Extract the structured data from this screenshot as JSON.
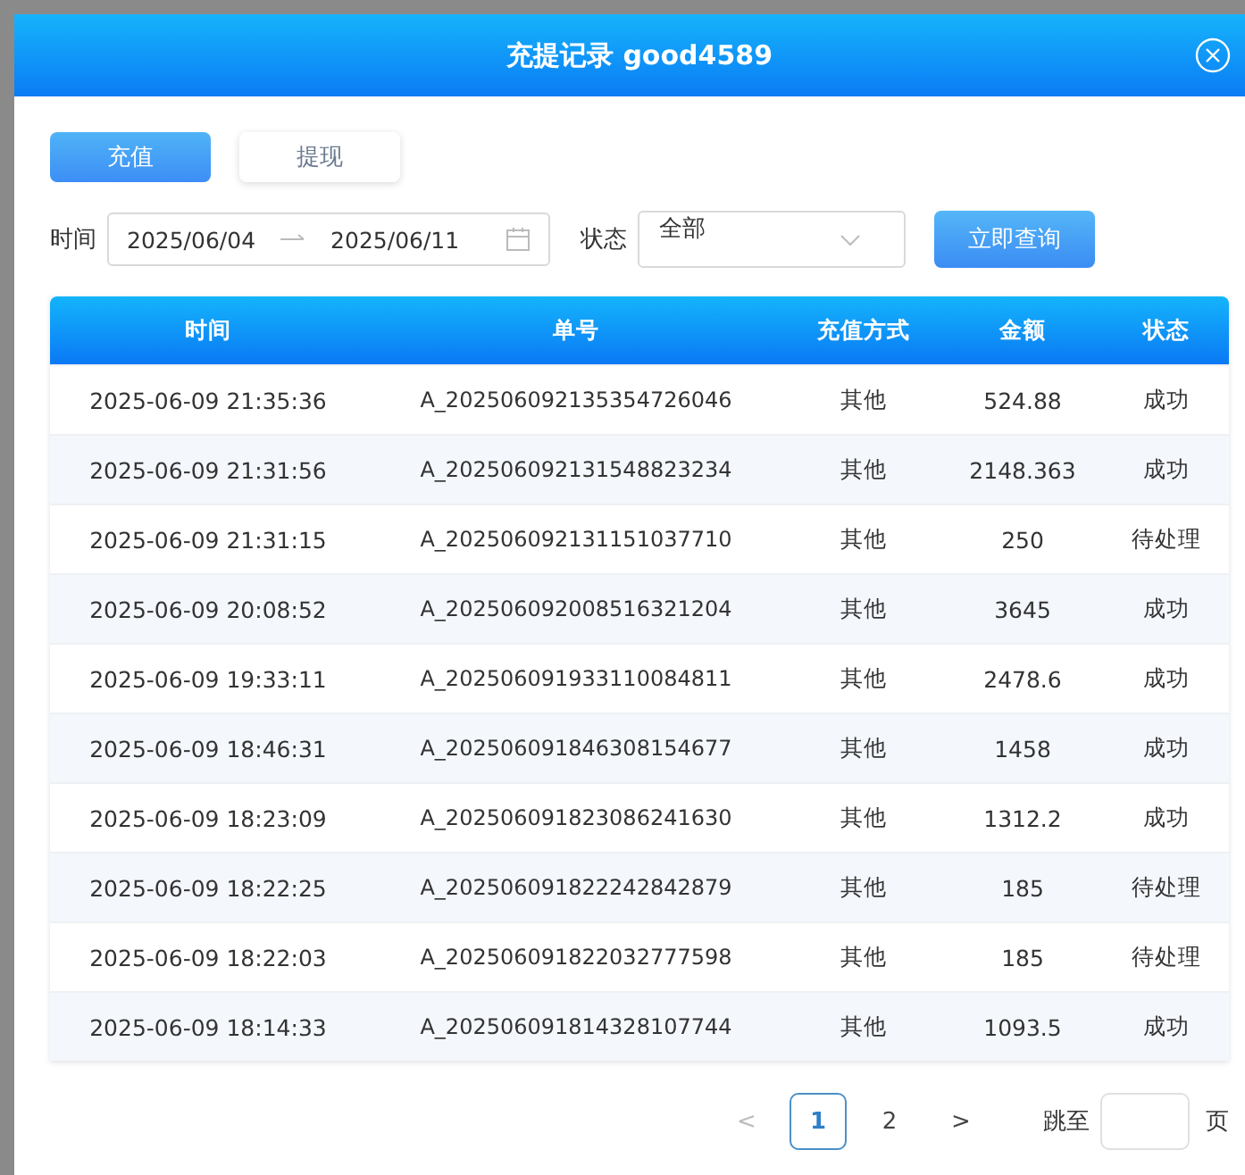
{
  "dialog": {
    "title": "充提记录 good4589"
  },
  "tabs": [
    {
      "label": "充值",
      "selected": true
    },
    {
      "label": "提现",
      "selected": false
    }
  ],
  "filters": {
    "time_label": "时间",
    "date_start": "2025/06/04",
    "date_end": "2025/06/11",
    "status_label": "状态",
    "status_value": "全部",
    "query_button": "立即查询"
  },
  "table": {
    "columns": [
      "时间",
      "单号",
      "充值方式",
      "金额",
      "状态"
    ],
    "rows": [
      [
        "2025-06-09 21:35:36",
        "A_202506092135354726046",
        "其他",
        "524.88",
        "成功"
      ],
      [
        "2025-06-09 21:31:56",
        "A_202506092131548823234",
        "其他",
        "2148.363",
        "成功"
      ],
      [
        "2025-06-09 21:31:15",
        "A_202506092131151037710",
        "其他",
        "250",
        "待处理"
      ],
      [
        "2025-06-09 20:08:52",
        "A_202506092008516321204",
        "其他",
        "3645",
        "成功"
      ],
      [
        "2025-06-09 19:33:11",
        "A_202506091933110084811",
        "其他",
        "2478.6",
        "成功"
      ],
      [
        "2025-06-09 18:46:31",
        "A_202506091846308154677",
        "其他",
        "1458",
        "成功"
      ],
      [
        "2025-06-09 18:23:09",
        "A_202506091823086241630",
        "其他",
        "1312.2",
        "成功"
      ],
      [
        "2025-06-09 18:22:25",
        "A_202506091822242842879",
        "其他",
        "185",
        "待处理"
      ],
      [
        "2025-06-09 18:22:03",
        "A_202506091822032777598",
        "其他",
        "185",
        "待处理"
      ],
      [
        "2025-06-09 18:14:33",
        "A_202506091814328107744",
        "其他",
        "1093.5",
        "成功"
      ]
    ]
  },
  "pagination": {
    "prev": "<",
    "pages": [
      {
        "label": "1",
        "selected": true
      },
      {
        "label": "2",
        "selected": false
      }
    ],
    "next": ">",
    "jump_label": "跳至",
    "page_suffix": "页"
  }
}
